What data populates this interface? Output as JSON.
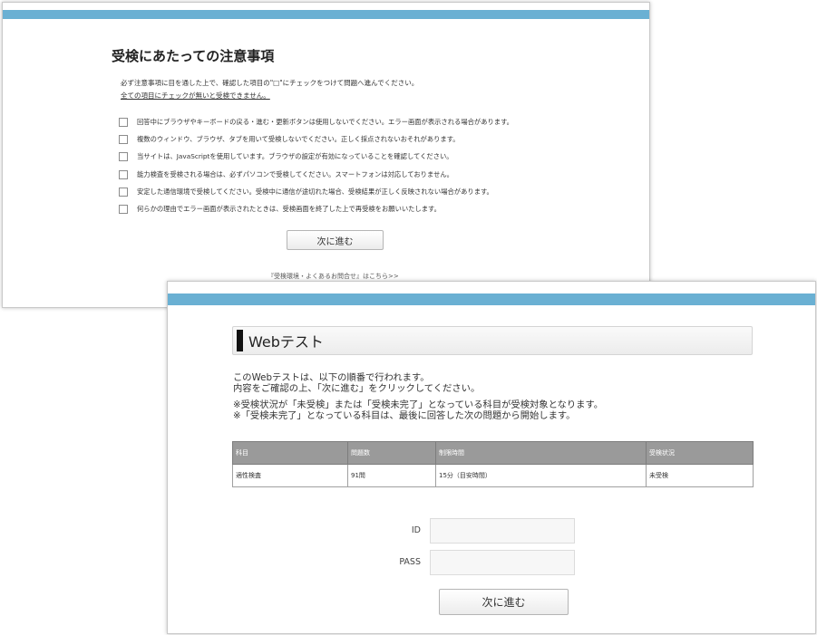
{
  "notice": {
    "title": "受検にあたっての注意事項",
    "intro_line1": "必ず注意事項に目を通した上で、確認した項目の\"□\"にチェックをつけて問題へ進んでください。",
    "intro_line2": "全ての項目にチェックが無いと受検できません。",
    "checklist": [
      "回答中にブラウザやキーボードの戻る・進む・更新ボタンは使用しないでください。エラー画面が表示される場合があります。",
      "複数のウィンドウ、ブラウザ、タブを用いて受検しないでください。正しく採点されないおそれがあります。",
      "当サイトは、JavaScriptを使用しています。ブラウザの設定が有効になっていることを確認してください。",
      "能力検査を受検される場合は、必ずパソコンで受検してください。スマートフォンは対応しておりません。",
      "安定した通信環境で受検してください。受検中に通信が途切れた場合、受検結果が正しく反映されない場合があります。",
      "何らかの理由でエラー画面が表示されたときは、受検画面を終了した上で再受検をお願いいたします。"
    ],
    "next_label": "次に進む",
    "faq_link": "『受検環境・よくあるお問合せ』はこちら>>"
  },
  "webtest": {
    "title": "Webテスト",
    "desc1": "このWebテストは、以下の順番で行われます。",
    "desc2": "内容をご確認の上、「次に進む」をクリックしてください。",
    "note1": "※受検状況が「未受検」または「受検未完了」となっている科目が受検対象となります。",
    "note2": "※「受検未完了」となっている科目は、最後に回答した次の問題から開始します。",
    "table": {
      "headers": [
        "科目",
        "問題数",
        "制限時間",
        "受検状況"
      ],
      "rows": [
        [
          "適性検査",
          "91問",
          "15分（目安時間）",
          "未受検"
        ]
      ]
    },
    "id_label": "ID",
    "pass_label": "PASS",
    "id_value": "",
    "pass_value": "",
    "next_label": "次に進む"
  },
  "colors": {
    "accent_bar": "#6ab0d3",
    "table_header": "#9a9a9a"
  }
}
